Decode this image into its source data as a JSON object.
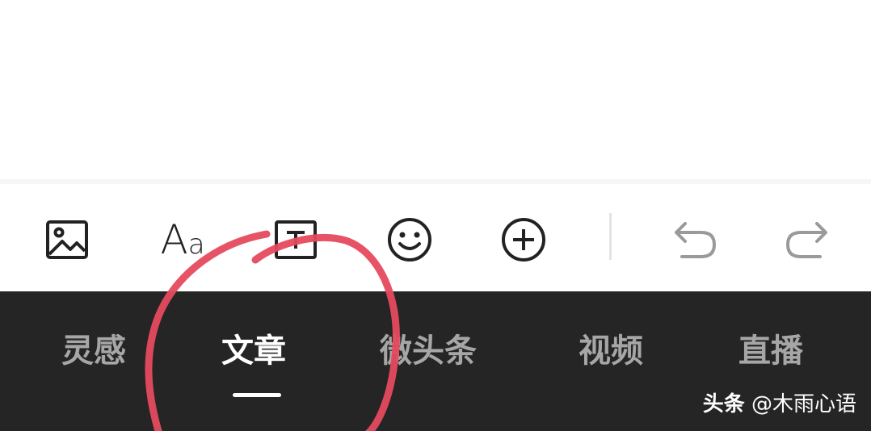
{
  "toolbar": {
    "image_tool": {
      "icon": "image-icon"
    },
    "font_tool": {
      "icon": "font-icon",
      "cap": "A",
      "low": "a"
    },
    "text_tool": {
      "icon": "text-box-icon"
    },
    "emoji_tool": {
      "icon": "emoji-icon"
    },
    "insert_tool": {
      "icon": "plus-circle-icon"
    },
    "undo_tool": {
      "icon": "undo-icon"
    },
    "redo_tool": {
      "icon": "redo-icon"
    }
  },
  "tabs": [
    {
      "label": "灵感"
    },
    {
      "label": "文章",
      "active": true
    },
    {
      "label": "微头条"
    },
    {
      "label": "视频"
    },
    {
      "label": "直播"
    }
  ],
  "watermark": {
    "brand": "头条",
    "handle": "@木雨心语"
  },
  "colors": {
    "tabbar_bg": "#252525",
    "tab_inactive": "#a6a6a6",
    "tab_active": "#ffffff",
    "annotation": "#e64a5e",
    "icon_inactive": "#9a9a9a"
  }
}
